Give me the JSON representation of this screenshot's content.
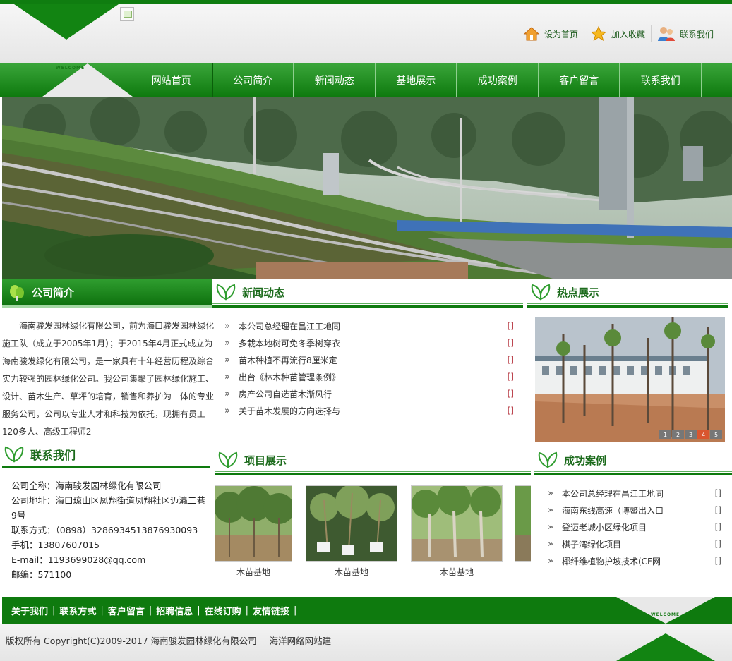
{
  "header": {
    "welcome": "WELCOME",
    "links": [
      {
        "label": "设为首页",
        "icon": "home-icon"
      },
      {
        "label": "加入收藏",
        "icon": "star-icon"
      },
      {
        "label": "联系我们",
        "icon": "contact-person-icon"
      }
    ]
  },
  "nav": [
    "网站首页",
    "公司简介",
    "新闻动态",
    "基地展示",
    "成功案例",
    "客户留言",
    "联系我们"
  ],
  "about": {
    "title": "公司简介",
    "text": "海南骏发园林绿化有限公司，前为海口骏发园林绿化施工队（成立于2005年1月）；于2015年4月正式成立为海南骏发绿化有限公司，是一家具有十年经营历程及综合实力较强的园林绿化公司。我公司集聚了园林绿化施工、设计、苗木生产、草坪的培育，销售和养护为一体的专业服务公司，公司以专业人才和科技为依托，现拥有员工120多人、高级工程师2"
  },
  "news": {
    "title": "新闻动态",
    "items": [
      {
        "text": "本公司总经理在昌江工地同",
        "tail": "[]"
      },
      {
        "text": "多栽本地树可免冬季树穿衣",
        "tail": "[]"
      },
      {
        "text": "苗木种植不再流行8厘米定",
        "tail": "[]"
      },
      {
        "text": "出台《林木种苗管理条例》",
        "tail": "[]"
      },
      {
        "text": "房产公司自选苗木渐风行",
        "tail": "[]"
      },
      {
        "text": "关于苗木发展的方向选择与",
        "tail": "[]"
      }
    ]
  },
  "hot": {
    "title": "热点展示",
    "pages": [
      "1",
      "2",
      "3",
      "4",
      "5"
    ]
  },
  "contact": {
    "title": "联系我们",
    "lines": [
      "公司全称：海南骏发园林绿化有限公司",
      "公司地址：海口琼山区凤翔街道凤翔社区迈瀛二巷9号",
      "联系方式：（0898）3286934513876930093",
      "手机：13807607015",
      "E-mail：1193699028@qq.com",
      "邮编：571100"
    ]
  },
  "projects": {
    "title": "项目展示",
    "items": [
      {
        "caption": "木苗基地"
      },
      {
        "caption": "木苗基地"
      },
      {
        "caption": "木苗基地"
      }
    ]
  },
  "cases": {
    "title": "成功案例",
    "items": [
      {
        "text": "本公司总经理在昌江工地同",
        "tail": "[]"
      },
      {
        "text": "海南东线高速（博鳌出入口",
        "tail": "[]"
      },
      {
        "text": "登迈老城小区绿化项目",
        "tail": "[]"
      },
      {
        "text": "棋子湾绿化项目",
        "tail": "[]"
      },
      {
        "text": "椰纤维植物护坡技术(CF网",
        "tail": "[]"
      }
    ]
  },
  "footer": {
    "links": [
      "关于我们",
      "联系方式",
      "客户留言",
      "招聘信息",
      "在线订购",
      "友情链接"
    ],
    "copyright": "版权所有 Copyright(C)2009-2017 海南骏发园林绿化有限公司",
    "builder": "海洋网络网站建"
  },
  "colors": {
    "brand_green": "#0e7a0e",
    "accent_red": "#b5333d"
  }
}
